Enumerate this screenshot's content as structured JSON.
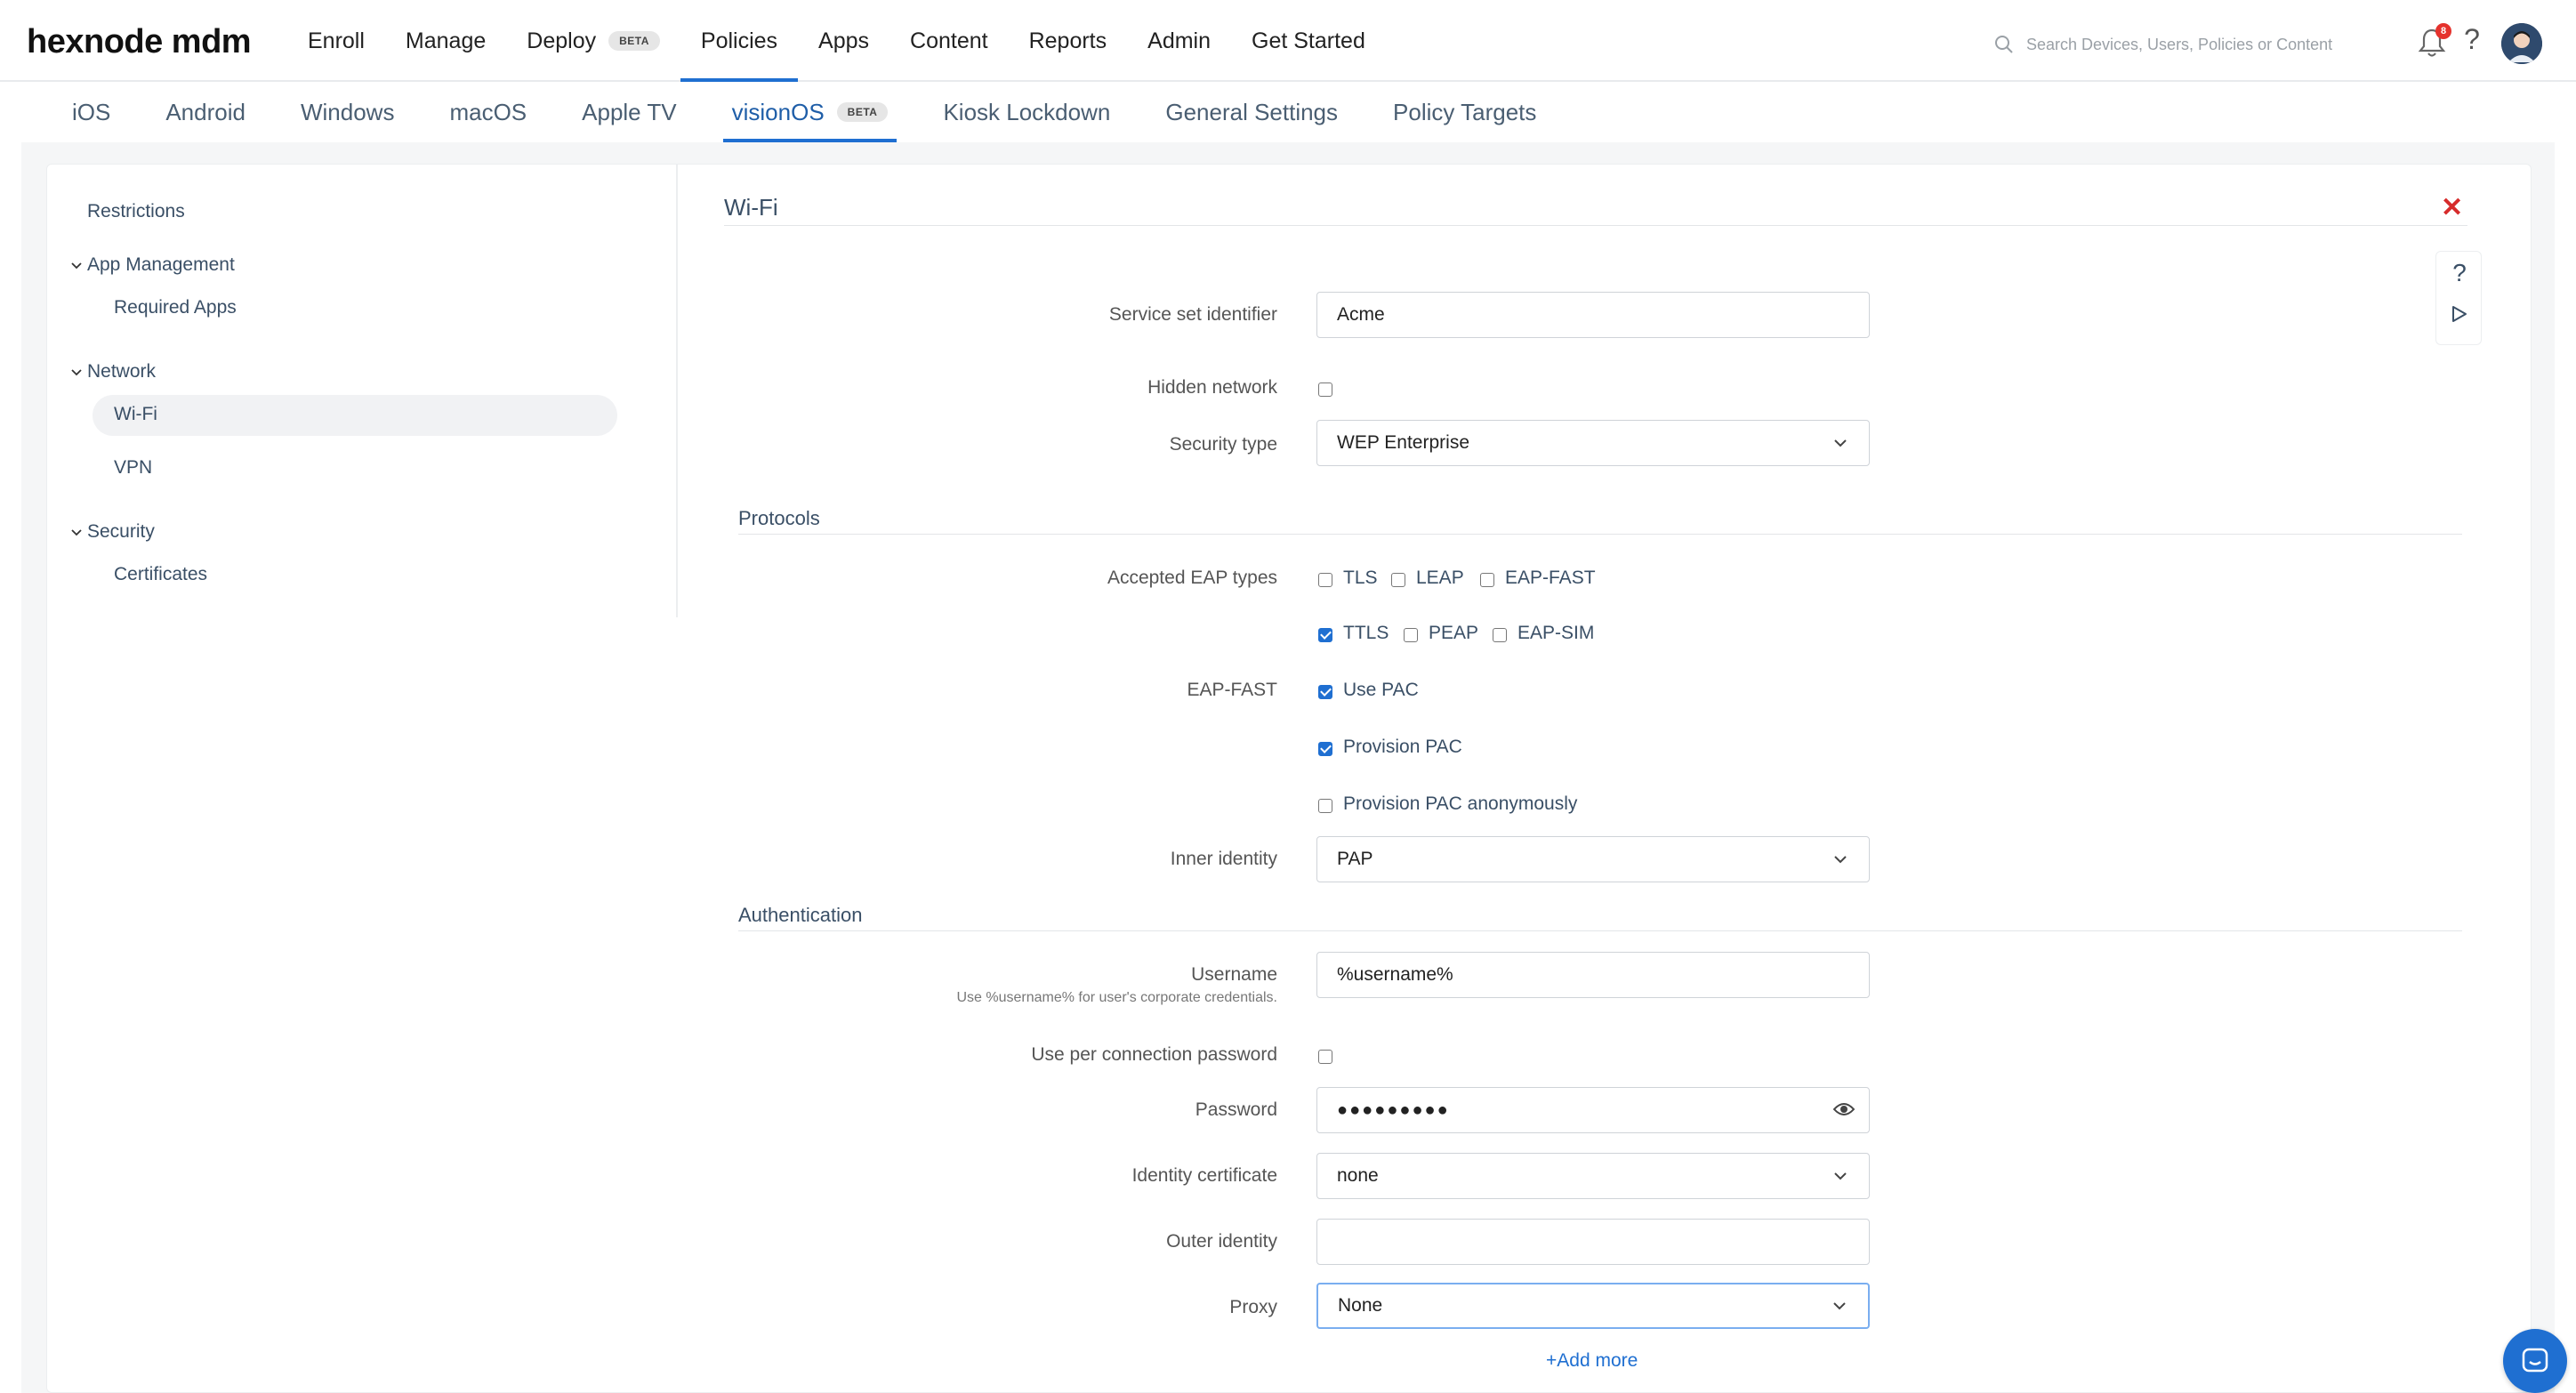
{
  "brand": {
    "logo": "hexnode mdm"
  },
  "topnav": {
    "items": [
      {
        "label": "Enroll"
      },
      {
        "label": "Manage"
      },
      {
        "label": "Deploy",
        "badge": "BETA"
      },
      {
        "label": "Policies",
        "active": true
      },
      {
        "label": "Apps"
      },
      {
        "label": "Content"
      },
      {
        "label": "Reports"
      },
      {
        "label": "Admin"
      },
      {
        "label": "Get Started"
      }
    ],
    "search_placeholder": "Search Devices, Users, Policies or Content",
    "notification_count": "8",
    "accent_color": "#1f6fd1"
  },
  "subtabs": {
    "items": [
      {
        "label": "iOS"
      },
      {
        "label": "Android"
      },
      {
        "label": "Windows"
      },
      {
        "label": "macOS"
      },
      {
        "label": "Apple TV"
      },
      {
        "label": "visionOS",
        "badge": "BETA",
        "active": true
      },
      {
        "label": "Kiosk Lockdown"
      },
      {
        "label": "General Settings"
      },
      {
        "label": "Policy Targets"
      }
    ]
  },
  "sidebar": {
    "restrictions": "Restrictions",
    "app_management": "App Management",
    "required_apps": "Required Apps",
    "network": "Network",
    "wifi": "Wi-Fi",
    "vpn": "VPN",
    "security": "Security",
    "certificates": "Certificates"
  },
  "form": {
    "title": "Wi-Fi",
    "ssid_label": "Service set identifier",
    "ssid_value": "Acme",
    "hidden_label": "Hidden network",
    "hidden_checked": false,
    "security_type_label": "Security type",
    "security_type_value": "WEP Enterprise",
    "protocols_section": "Protocols",
    "eap_types_label": "Accepted EAP types",
    "eap_types": [
      {
        "label": "TLS",
        "checked": false
      },
      {
        "label": "LEAP",
        "checked": false
      },
      {
        "label": "EAP-FAST",
        "checked": false
      },
      {
        "label": "TTLS",
        "checked": true
      },
      {
        "label": "PEAP",
        "checked": false
      },
      {
        "label": "EAP-SIM",
        "checked": false
      }
    ],
    "eap_fast_label": "EAP-FAST",
    "use_pac": {
      "label": "Use PAC",
      "checked": true
    },
    "provision_pac": {
      "label": "Provision PAC",
      "checked": true
    },
    "provision_pac_anon": {
      "label": "Provision PAC anonymously",
      "checked": false
    },
    "inner_identity_label": "Inner identity",
    "inner_identity_value": "PAP",
    "authentication_section": "Authentication",
    "username_label": "Username",
    "username_hint": "Use %username% for user's corporate credentials.",
    "username_value": "%username%",
    "per_conn_pw_label": "Use per connection password",
    "per_conn_pw_checked": false,
    "password_label": "Password",
    "password_value": "●●●●●●●●●",
    "identity_cert_label": "Identity certificate",
    "identity_cert_value": "none",
    "outer_identity_label": "Outer identity",
    "outer_identity_value": "",
    "proxy_label": "Proxy",
    "proxy_value": "None",
    "add_more": "+Add more"
  }
}
